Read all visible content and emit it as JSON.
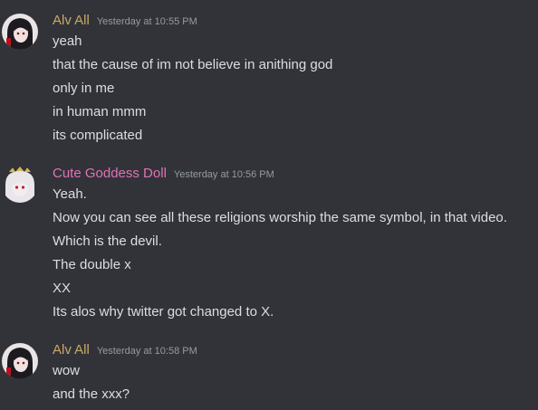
{
  "colors": {
    "background": "#313338",
    "message_text": "#dbdee1",
    "timestamp": "#949ba4",
    "user_alv": "#c9a86a",
    "user_goddess": "#e272b5"
  },
  "messages": [
    {
      "username": "Alv All",
      "timestamp": "Yesterday at 10:55 PM",
      "avatar_icon": "dark-haired-character-avatar",
      "lines": [
        "yeah",
        "that the cause of im not believe in anithing god",
        "only in me",
        "in human mmm",
        "its complicated"
      ]
    },
    {
      "username": "Cute Goddess Doll",
      "timestamp": "Yesterday at 10:56 PM",
      "avatar_icon": "white-haired-character-avatar",
      "lines": [
        "Yeah.",
        "Now you can see all these religions worship the same symbol, in that video.",
        "Which is the devil.",
        "The double x",
        "XX",
        "Its alos why twitter got changed to X."
      ]
    },
    {
      "username": "Alv All",
      "timestamp": "Yesterday at 10:58 PM",
      "avatar_icon": "dark-haired-character-avatar",
      "lines": [
        "wow",
        "and the xxx?"
      ]
    }
  ]
}
